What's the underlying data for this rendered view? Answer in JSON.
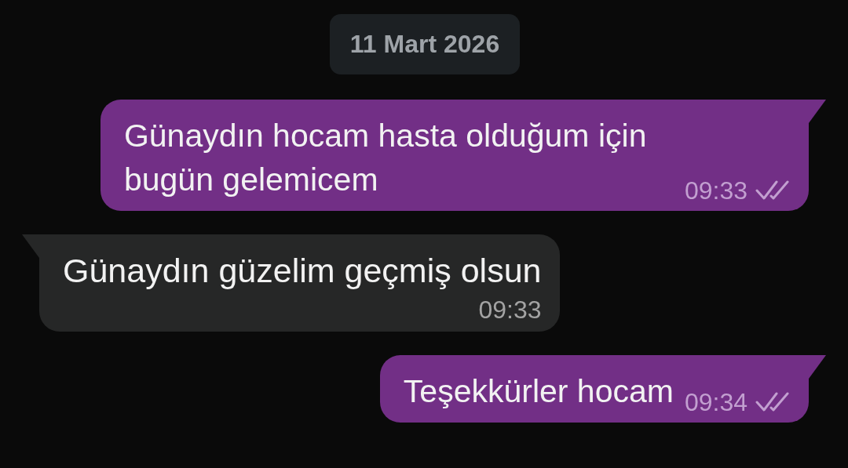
{
  "date_separator": "11 Mart 2026",
  "messages": [
    {
      "kind": "outgoing",
      "text": "Günaydın hocam hasta olduğum için bugün gelemicem",
      "time": "09:33"
    },
    {
      "kind": "incoming",
      "text": "Günaydın güzelim geçmiş olsun",
      "time": "09:33"
    },
    {
      "kind": "outgoing",
      "text": "Teşekkürler hocam",
      "time": "09:34"
    }
  ]
}
